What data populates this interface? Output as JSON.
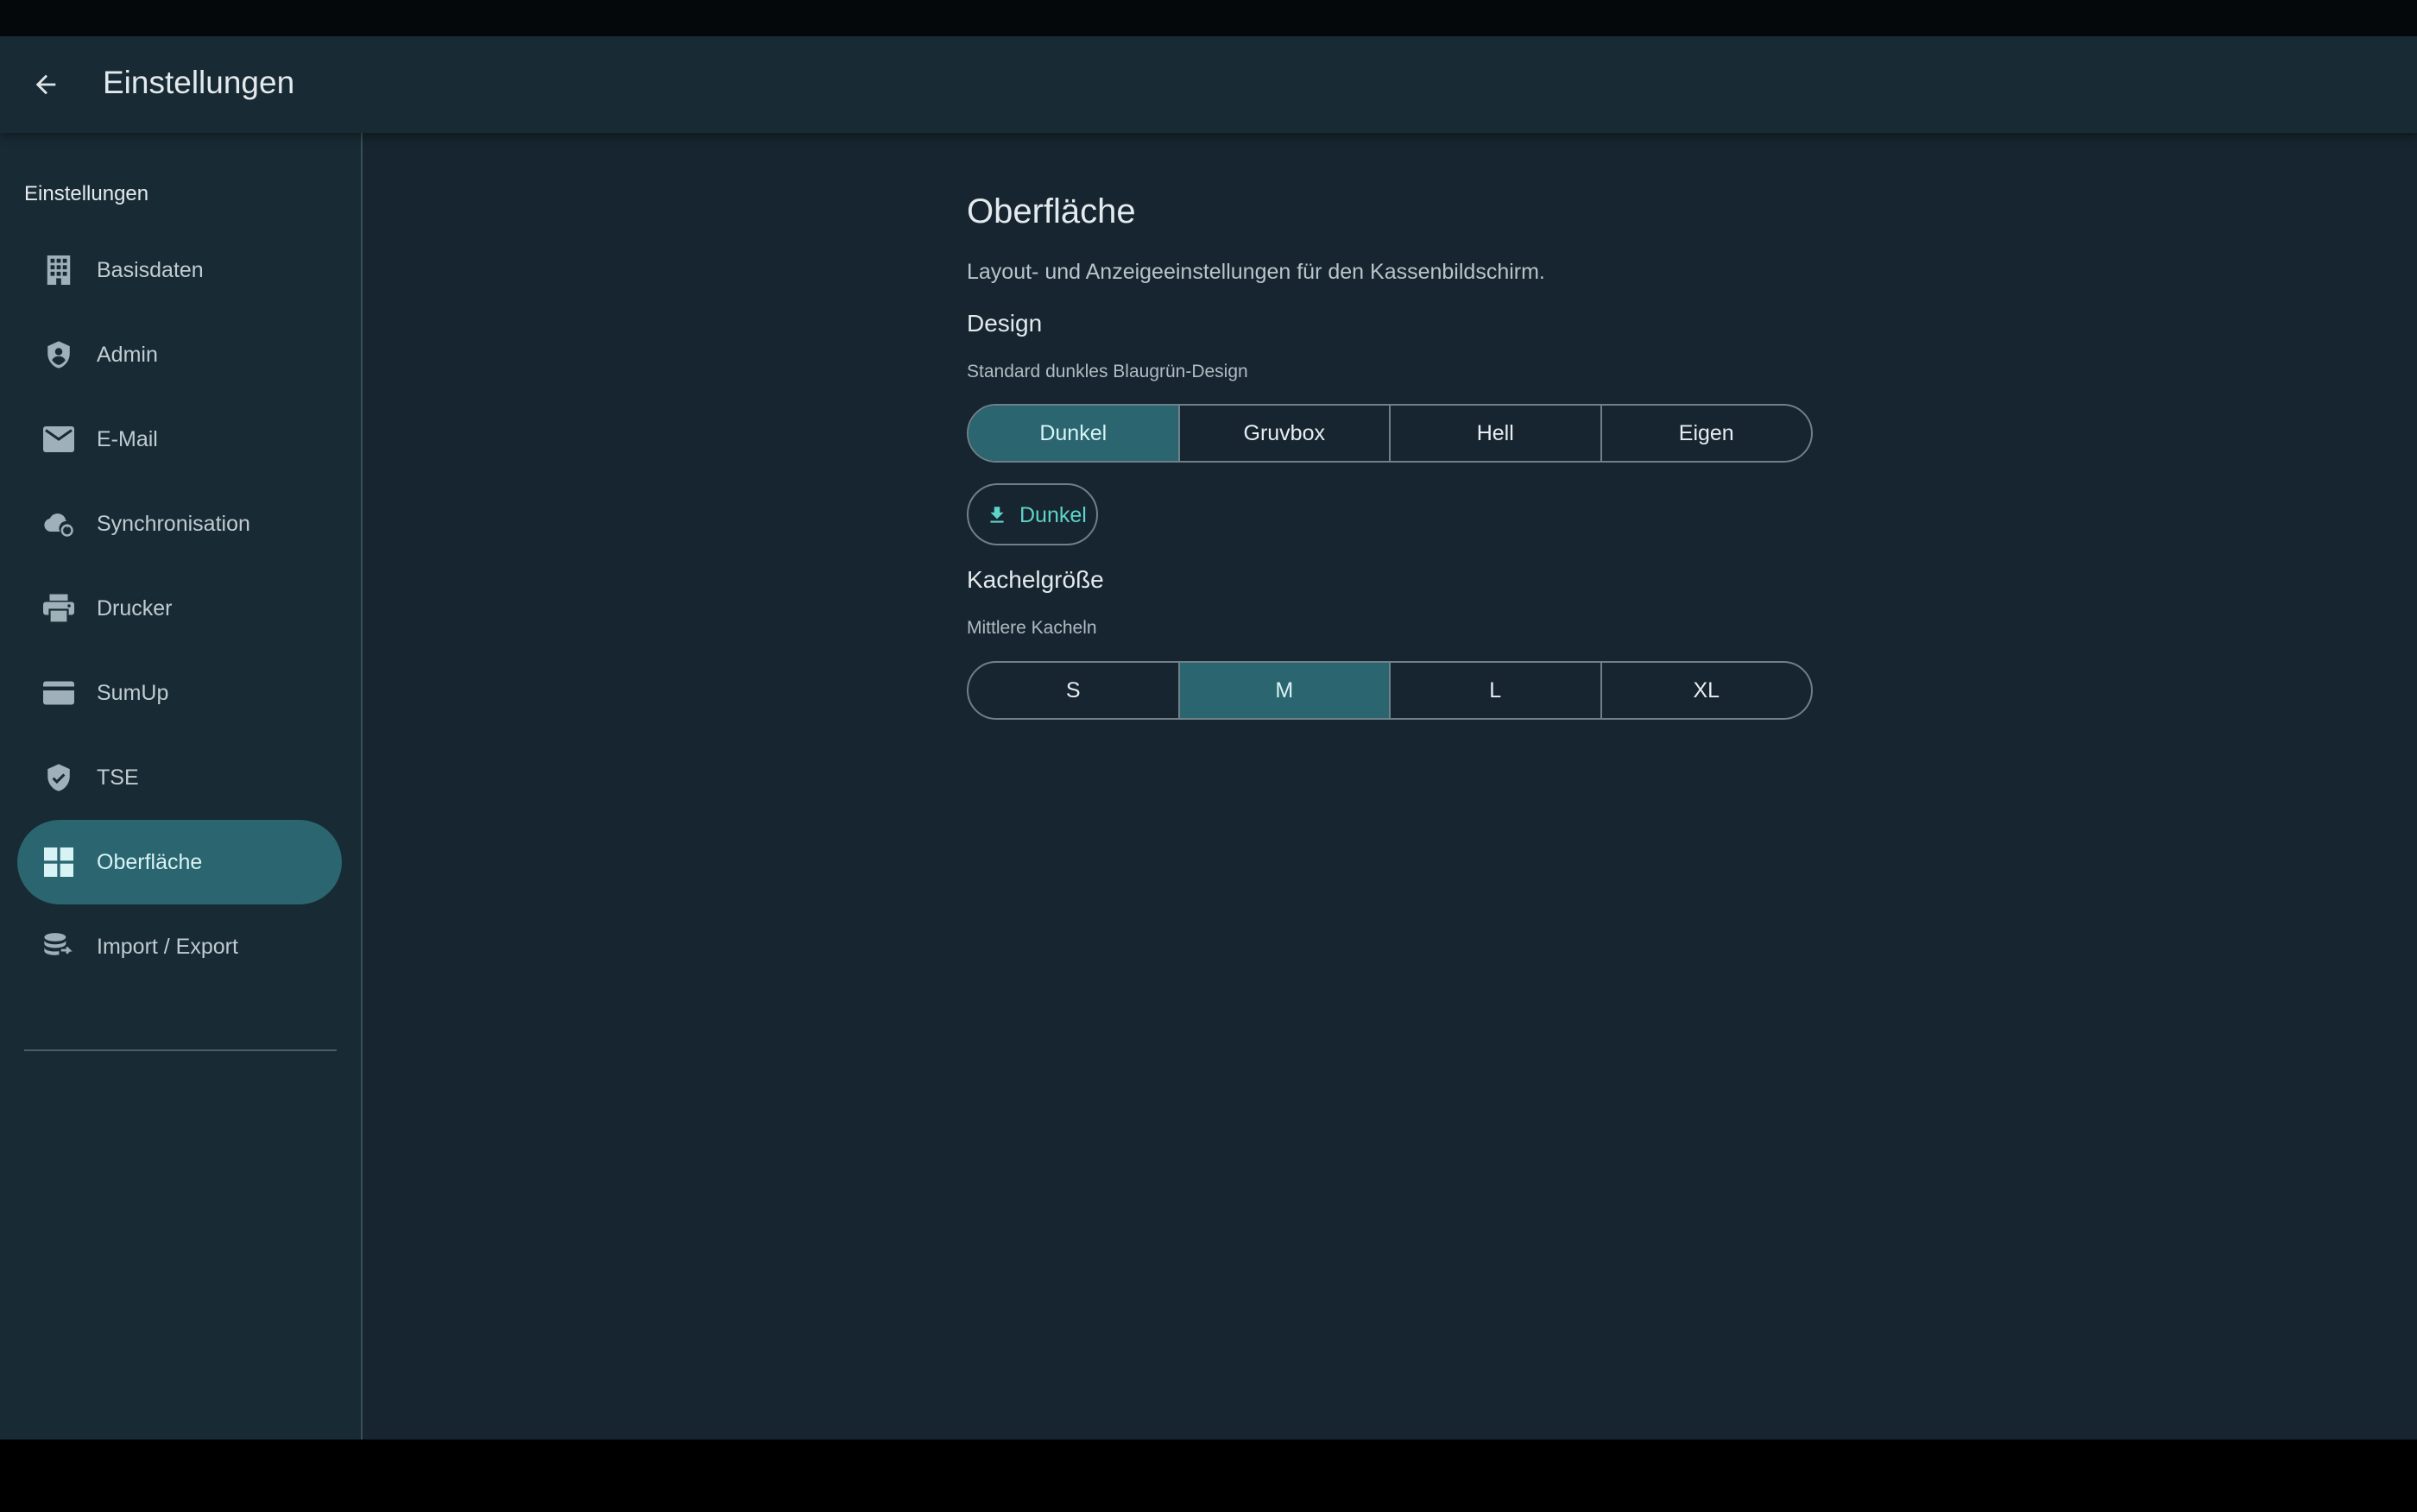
{
  "appbar": {
    "title": "Einstellungen",
    "back_icon": "arrow-left-icon"
  },
  "sidebar": {
    "header": "Einstellungen",
    "items": [
      {
        "label": "Basisdaten",
        "icon": "building-icon",
        "active": false
      },
      {
        "label": "Admin",
        "icon": "shield-account-icon",
        "active": false
      },
      {
        "label": "E-Mail",
        "icon": "envelope-icon",
        "active": false
      },
      {
        "label": "Synchronisation",
        "icon": "cloud-sync-icon",
        "active": false
      },
      {
        "label": "Drucker",
        "icon": "printer-icon",
        "active": false
      },
      {
        "label": "SumUp",
        "icon": "credit-card-icon",
        "active": false
      },
      {
        "label": "TSE",
        "icon": "shield-check-icon",
        "active": false
      },
      {
        "label": "Oberfläche",
        "icon": "grid-icon",
        "active": true
      },
      {
        "label": "Import / Export",
        "icon": "database-export-icon",
        "active": false
      }
    ]
  },
  "main": {
    "title": "Oberfläche",
    "subtitle": "Layout- und Anzeigeeinstellungen für den Kassenbildschirm.",
    "design": {
      "title": "Design",
      "caption": "Standard dunkles Blaugrün-Design",
      "options": [
        "Dunkel",
        "Gruvbox",
        "Hell",
        "Eigen"
      ],
      "selected": "Dunkel",
      "export_button": {
        "label": "Dunkel",
        "icon": "download-icon"
      }
    },
    "tile_size": {
      "title": "Kachelgröße",
      "caption": "Mittlere Kacheln",
      "options": [
        "S",
        "M",
        "L",
        "XL"
      ],
      "selected": "M"
    }
  },
  "colors": {
    "background": "#16252f",
    "surface": "#182a33",
    "accent": "#2a6570",
    "accent_text": "#5fd3c9",
    "text": "#e3eaee"
  }
}
